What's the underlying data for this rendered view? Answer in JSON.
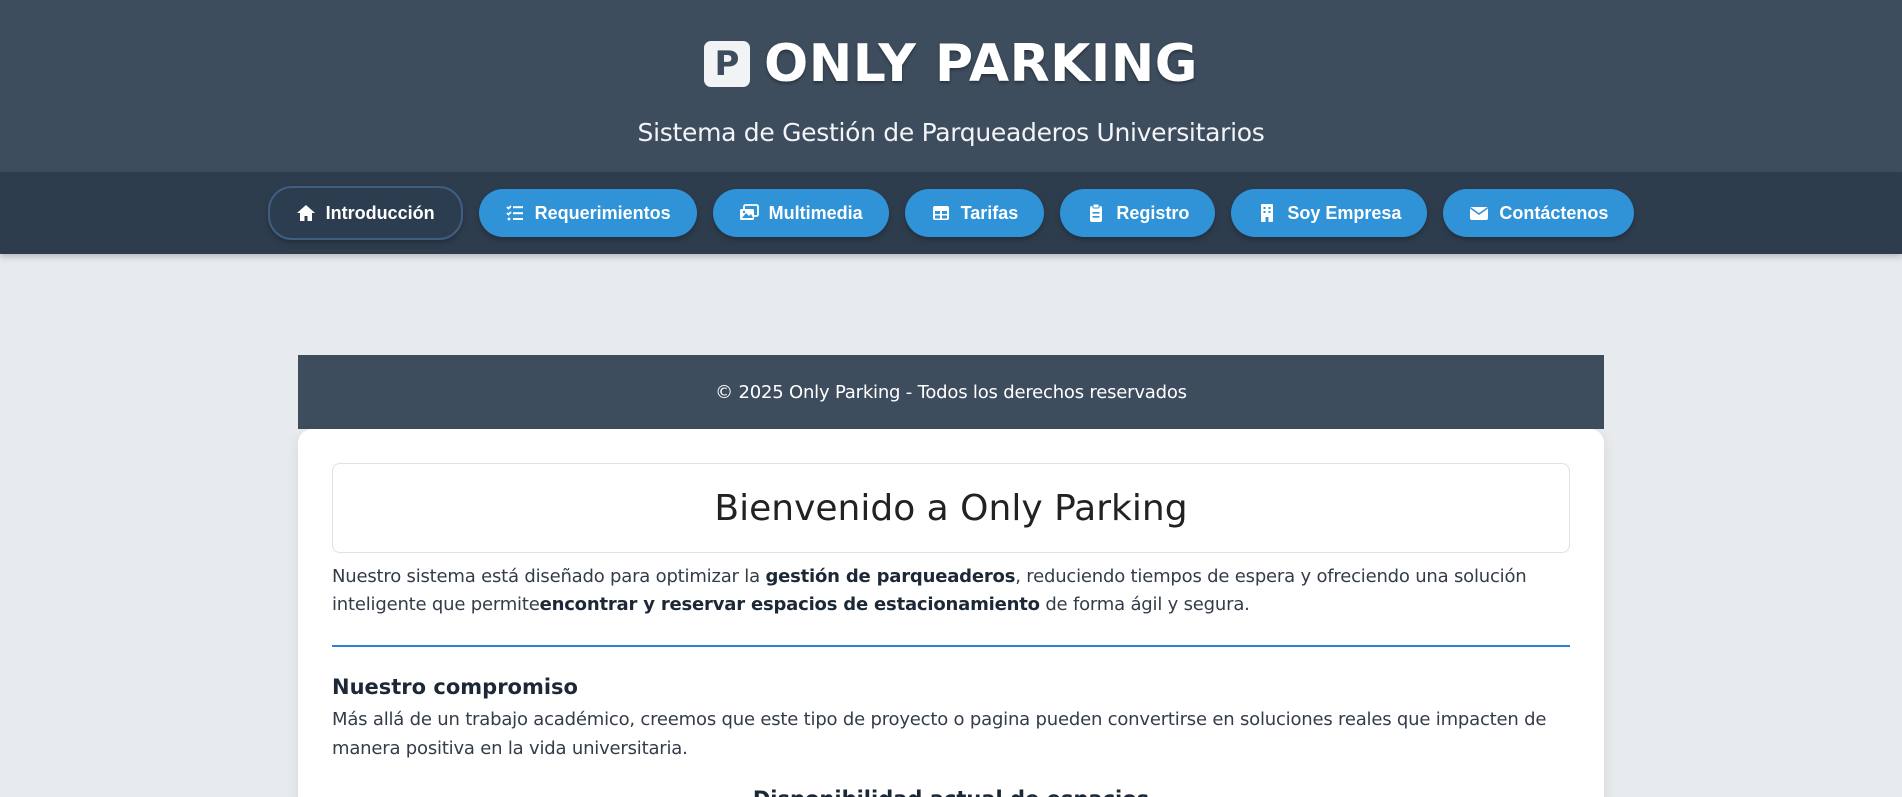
{
  "header": {
    "logo_letter": "P",
    "title": "ONLY PARKING",
    "subtitle": "Sistema de Gestión de Parqueaderos Universitarios"
  },
  "nav": {
    "items": [
      {
        "label": "Introducción",
        "icon": "home-icon",
        "active": true
      },
      {
        "label": "Requerimientos",
        "icon": "checklist-icon",
        "active": false
      },
      {
        "label": "Multimedia",
        "icon": "images-icon",
        "active": false
      },
      {
        "label": "Tarifas",
        "icon": "table-icon",
        "active": false
      },
      {
        "label": "Registro",
        "icon": "clipboard-icon",
        "active": false
      },
      {
        "label": "Soy Empresa",
        "icon": "building-icon",
        "active": false
      },
      {
        "label": "Contáctenos",
        "icon": "envelope-icon",
        "active": false
      }
    ]
  },
  "footer": {
    "copyright": "© 2025 Only Parking - Todos los derechos reservados"
  },
  "content": {
    "welcome_title": "Bienvenido a Only Parking",
    "intro": {
      "part1": "Nuestro sistema está diseñado para optimizar la ",
      "bold1": "gestión de parqueaderos",
      "part2": ", reduciendo tiempos de espera y ofreciendo una solución inteligente que permite",
      "bold2": "encontrar y reservar espacios de estacionamiento",
      "part3": " de forma ágil y segura."
    },
    "commitment_title": "Nuestro compromiso",
    "commitment_text": "Más allá de un trabajo académico, creemos que este tipo de proyecto o pagina pueden convertirse en soluciones reales que impacten de manera positiva en la vida universitaria.",
    "availability_title": "Disponibilidad actual de espacios"
  },
  "colors": {
    "header_bg": "#3e4d5e",
    "nav_bg": "#2e3d4e",
    "button_bg": "#3093d8",
    "divider": "#2f7fd7"
  }
}
